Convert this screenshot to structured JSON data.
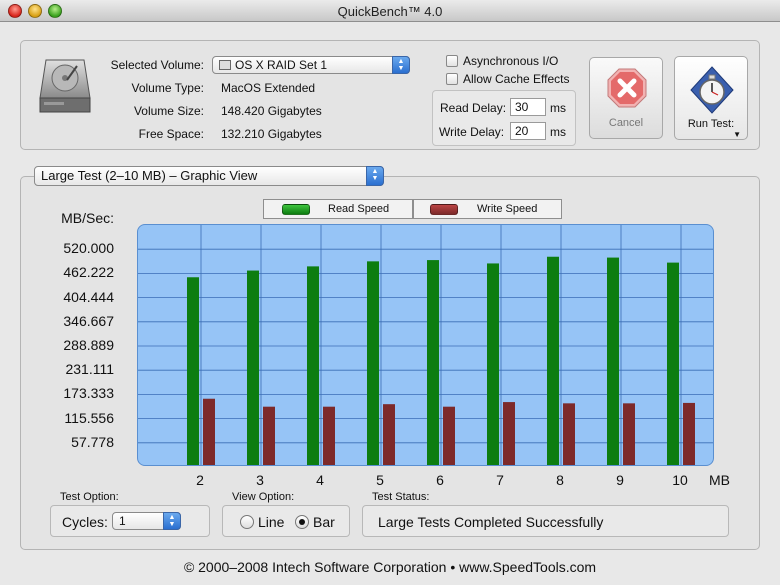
{
  "window": {
    "title": "QuickBench™ 4.0"
  },
  "volume": {
    "selected_label": "Selected Volume:",
    "selected_value": "OS X RAID Set 1",
    "type_label": "Volume Type:",
    "type_value": "MacOS Extended",
    "size_label": "Volume Size:",
    "size_value": "148.420 Gigabytes",
    "free_label": "Free Space:",
    "free_value": "132.210 Gigabytes"
  },
  "options": {
    "async_label": "Asynchronous I/O",
    "async_checked": false,
    "cache_label": "Allow Cache Effects",
    "cache_checked": false,
    "read_delay_label": "Read Delay:",
    "read_delay_value": "30",
    "write_delay_label": "Write Delay:",
    "write_delay_value": "20",
    "unit": "ms"
  },
  "buttons": {
    "cancel_label": "Cancel",
    "run_label": "Run Test:"
  },
  "graph": {
    "view_select": "Large Test (2–10 MB) – Graphic View",
    "legend": {
      "read": "Read Speed",
      "write": "Write Speed"
    },
    "y_unit": "MB/Sec:",
    "x_unit": "MB"
  },
  "chart_data": {
    "type": "bar",
    "ylabel": "MB/Sec:",
    "xlabel": "MB",
    "categories": [
      "2",
      "3",
      "4",
      "5",
      "6",
      "7",
      "8",
      "9",
      "10"
    ],
    "yticks": [
      "520.000",
      "462.222",
      "404.444",
      "346.667",
      "288.889",
      "231.111",
      "173.333",
      "115.556",
      "57.778"
    ],
    "ylim": [
      0,
      577.778
    ],
    "series": [
      {
        "name": "Read Speed",
        "color": "#0d7d10",
        "values": [
          453,
          469,
          479,
          491,
          494,
          486,
          502,
          500,
          488
        ]
      },
      {
        "name": "Write Speed",
        "color": "#7d2a2a",
        "values": [
          163,
          144,
          144,
          150,
          144,
          155,
          152,
          152,
          153
        ]
      }
    ],
    "grid": true,
    "legend_position": "top"
  },
  "bottom": {
    "test_option_label": "Test Option:",
    "cycles_label": "Cycles:",
    "cycles_value": "1",
    "view_option_label": "View Option:",
    "line_label": "Line",
    "bar_label": "Bar",
    "selected_view": "Bar",
    "status_label": "Test Status:",
    "status_value": "Large Tests Completed Successfully"
  },
  "footer": "© 2000–2008 Intech Software Corporation • www.SpeedTools.com"
}
